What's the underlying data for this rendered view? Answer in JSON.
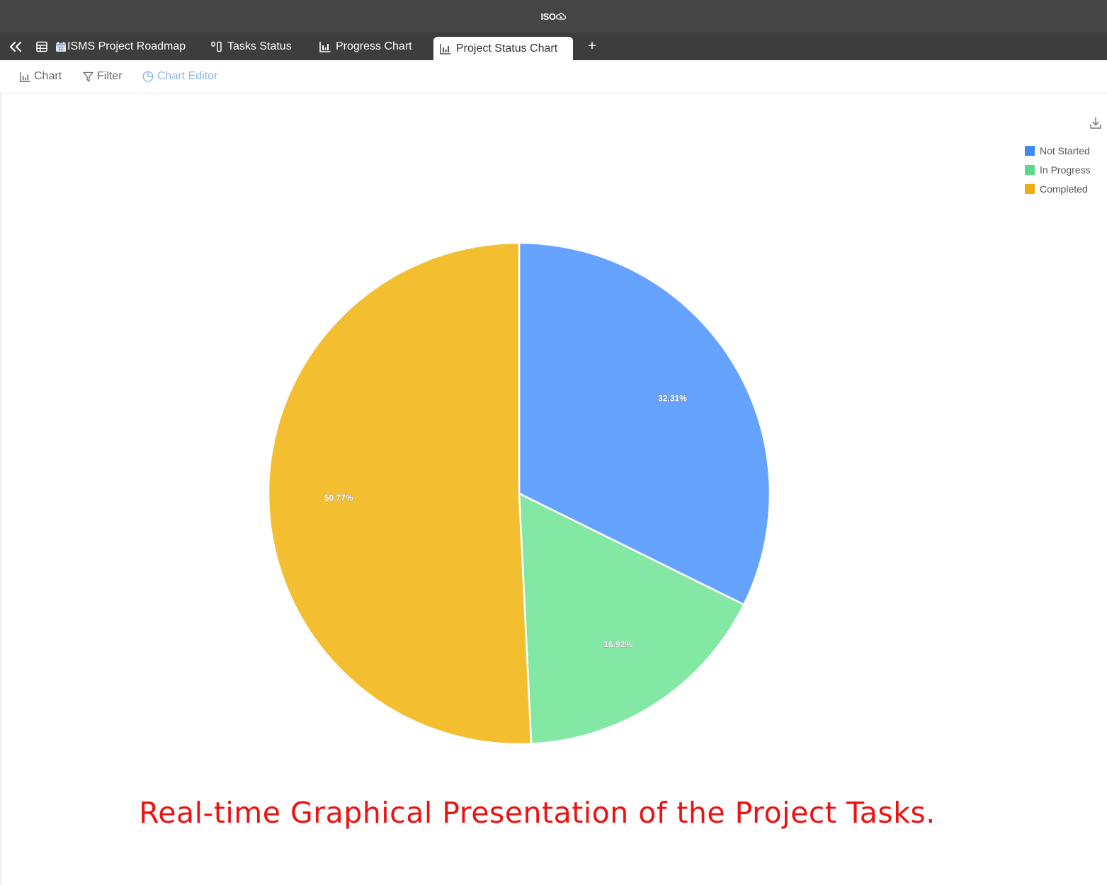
{
  "app": {
    "logo_text": "ISO"
  },
  "tabs": [
    {
      "label": "ISMS Project Roadmap",
      "icon": "calendar-icon"
    },
    {
      "label": "Tasks Status",
      "icon": "kanban-icon"
    },
    {
      "label": "Progress Chart",
      "icon": "bar-chart-icon"
    },
    {
      "label": "Project Status Chart",
      "icon": "bar-chart-icon",
      "active": true
    }
  ],
  "add_tab_label": "+",
  "toolbar": {
    "chart_label": "Chart",
    "filter_label": "Filter",
    "chart_editor_label": "Chart Editor"
  },
  "chart_data": {
    "type": "pie",
    "categories": [
      "Not Started",
      "In Progress",
      "Completed"
    ],
    "values": [
      32.31,
      16.92,
      50.77
    ],
    "value_labels": [
      "32.31%",
      "16.92%",
      "50.77%"
    ],
    "colors": [
      "#66a3ff",
      "#84e8a5",
      "#f3bf30"
    ],
    "legend_colors": [
      "#4189f0",
      "#5ed98a",
      "#f0ad10"
    ],
    "legend_position": "top-right",
    "start_angle_deg": 0,
    "direction": "clockwise"
  },
  "caption": "Real-time Graphical Presentation of the Project Tasks."
}
